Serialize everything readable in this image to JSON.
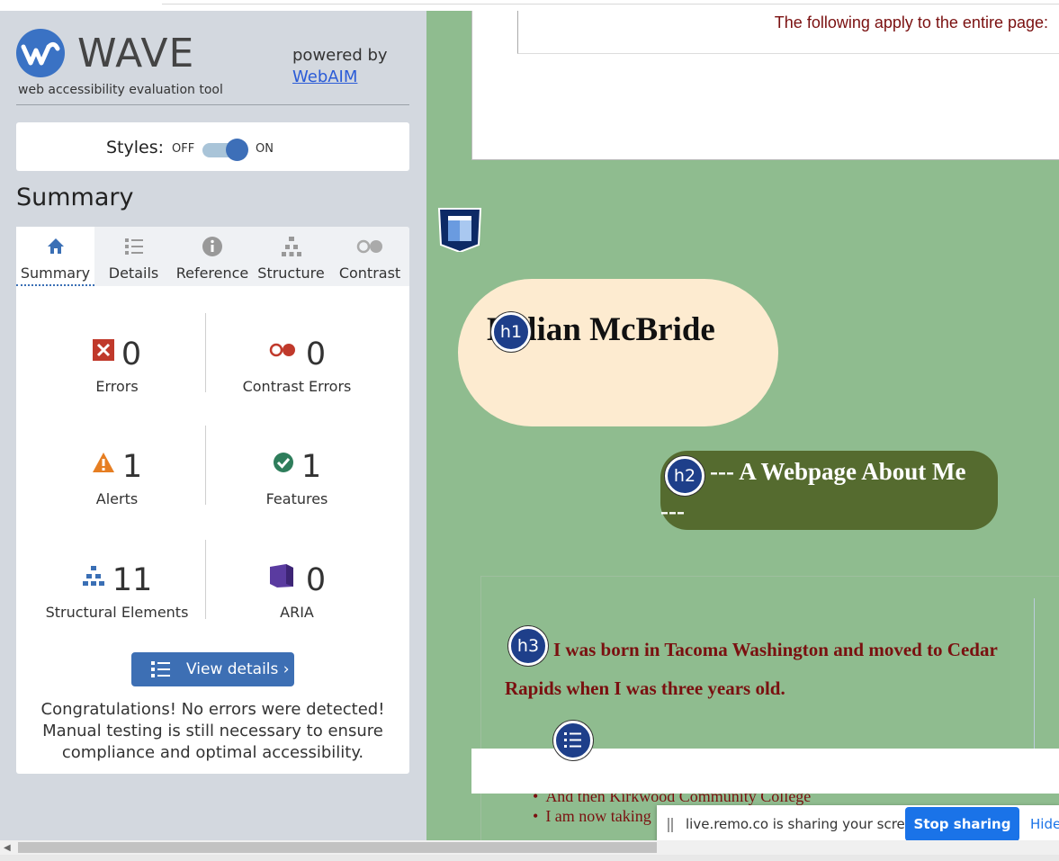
{
  "wave": {
    "logo_letter": "W",
    "title": "WAVE",
    "subtitle": "web accessibility evaluation tool",
    "powered_by": "powered by",
    "webaim_link": "WebAIM"
  },
  "styles": {
    "label": "Styles:",
    "off": "OFF",
    "on": "ON",
    "state": "on"
  },
  "summary_heading": "Summary",
  "tabs": [
    {
      "label": "Summary",
      "icon": "home-icon"
    },
    {
      "label": "Details",
      "icon": "list-icon"
    },
    {
      "label": "Reference",
      "icon": "info-icon"
    },
    {
      "label": "Structure",
      "icon": "hierarchy-icon"
    },
    {
      "label": "Contrast",
      "icon": "contrast-icon"
    }
  ],
  "stats": {
    "errors": {
      "value": "0",
      "label": "Errors"
    },
    "contrast_errors": {
      "value": "0",
      "label": "Contrast Errors"
    },
    "alerts": {
      "value": "1",
      "label": "Alerts"
    },
    "features": {
      "value": "1",
      "label": "Features"
    },
    "structural": {
      "value": "11",
      "label": "Structural Elements"
    },
    "aria": {
      "value": "0",
      "label": "ARIA"
    }
  },
  "view_details": "View details ›",
  "congrats": "Congratulations! No errors were detected! Manual testing is still necessary to ensure compliance and optimal accessibility.",
  "page": {
    "apply_text": "The following apply to the entire page:",
    "h1": "Lillian McBride",
    "h2": "--- A Webpage About Me",
    "h2_cont": "---",
    "h3": "I was born in Tacoma Washington and moved to Cedar Rapids when I was three years old.",
    "list_items": [
      "And then Kirkwood Community College",
      "I am now taking"
    ],
    "badges": {
      "h1": "h1",
      "h2": "h2",
      "h3": "h3"
    }
  },
  "share_bar": {
    "message": "live.remo.co is sharing your screen.",
    "stop": "Stop sharing",
    "hide": "Hide"
  },
  "colors": {
    "wave_blue": "#3a72c4",
    "page_green": "#8fbc8f",
    "h2_bg": "#556b2f",
    "h1_bg": "#fdebd0",
    "text_maroon": "#7a1010",
    "share_blue": "#1a73e8"
  }
}
